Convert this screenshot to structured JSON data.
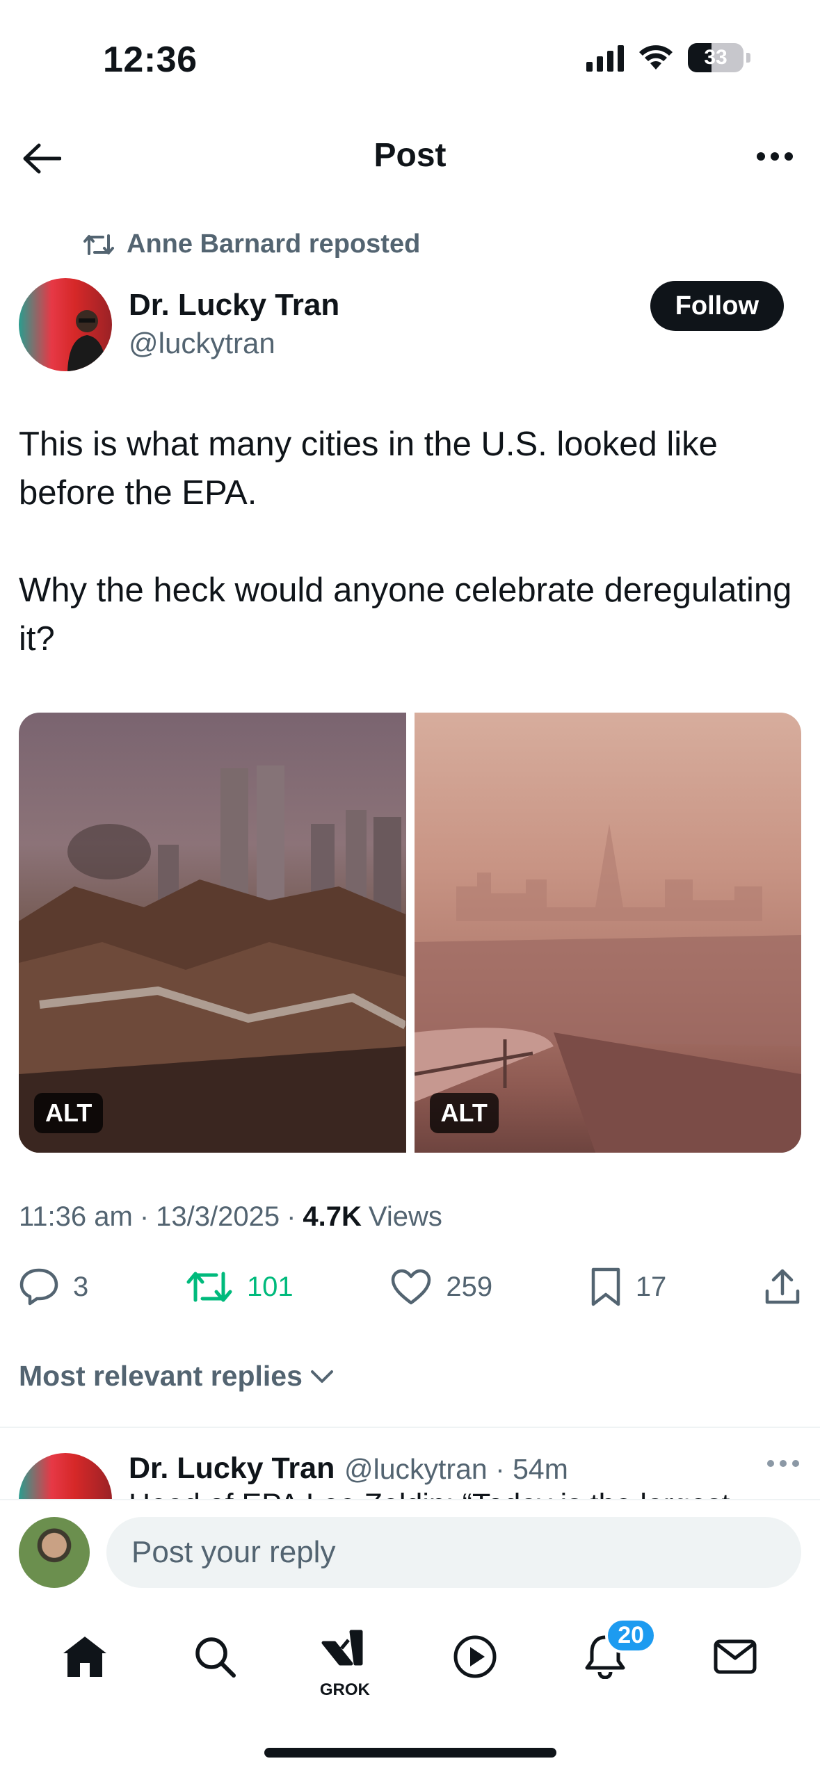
{
  "status_bar": {
    "time": "12:36",
    "battery": "33"
  },
  "header": {
    "title": "Post"
  },
  "repost": {
    "text": "Anne Barnard reposted"
  },
  "author": {
    "name": "Dr. Lucky Tran",
    "handle": "@luckytran",
    "follow_label": "Follow"
  },
  "post": {
    "text": "This is what many cities in the U.S. looked like before the EPA.\n\nWhy the heck would anyone celebrate deregulating it?",
    "images": [
      {
        "alt_label": "ALT"
      },
      {
        "alt_label": "ALT"
      }
    ],
    "time": "11:36 am",
    "date": "13/3/2025",
    "views_count": "4.7K",
    "views_label": "Views"
  },
  "actions": {
    "replies": "3",
    "reposts": "101",
    "likes": "259",
    "bookmarks": "17"
  },
  "replies_sort": {
    "label": "Most relevant replies"
  },
  "reply_preview": {
    "name": "Dr. Lucky Tran",
    "handle_time": "@luckytran · 54m",
    "snippet": "Head of EPA Lee Zeldin: “Today is the largest"
  },
  "composer": {
    "placeholder": "Post your reply"
  },
  "bottom_nav": {
    "grok_label": "GROK",
    "notifications_badge": "20"
  },
  "colors": {
    "accent": "#1d9bf0",
    "repost_green": "#00ba7c",
    "muted": "#536471"
  }
}
